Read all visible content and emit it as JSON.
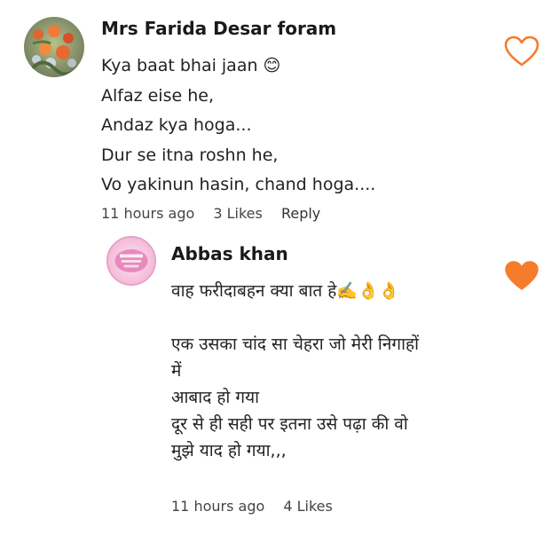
{
  "comment": {
    "author": "Mrs Farida Desar foram",
    "lines": [
      "Kya baat bhai jaan 😊",
      "Alfaz  eise he,",
      "Andaz kya hoga...",
      "Dur se itna roshn he,",
      "Vo yakinun  hasin, chand hoga...."
    ],
    "time": "11 hours ago",
    "likes": "3 Likes",
    "reply_label": "Reply",
    "liked": false,
    "like_icon": "heart-outline-icon",
    "like_color": "#f57c2a"
  },
  "reply": {
    "author": "Abbas khan",
    "lines": [
      "वाह फरीदाबहन क्या बात हे✍️👌👌",
      "",
      "एक उसका चांद सा चेहरा जो मेरी निगाहों",
      "में",
      "आबाद हो गया",
      "दूर से ही सही पर इतना उसे पढ़ा की वो",
      "मुझे याद हो गया,,,"
    ],
    "time": "11 hours ago",
    "likes": "4 Likes",
    "liked": true,
    "like_icon": "heart-filled-icon",
    "like_color": "#f57c2a"
  }
}
